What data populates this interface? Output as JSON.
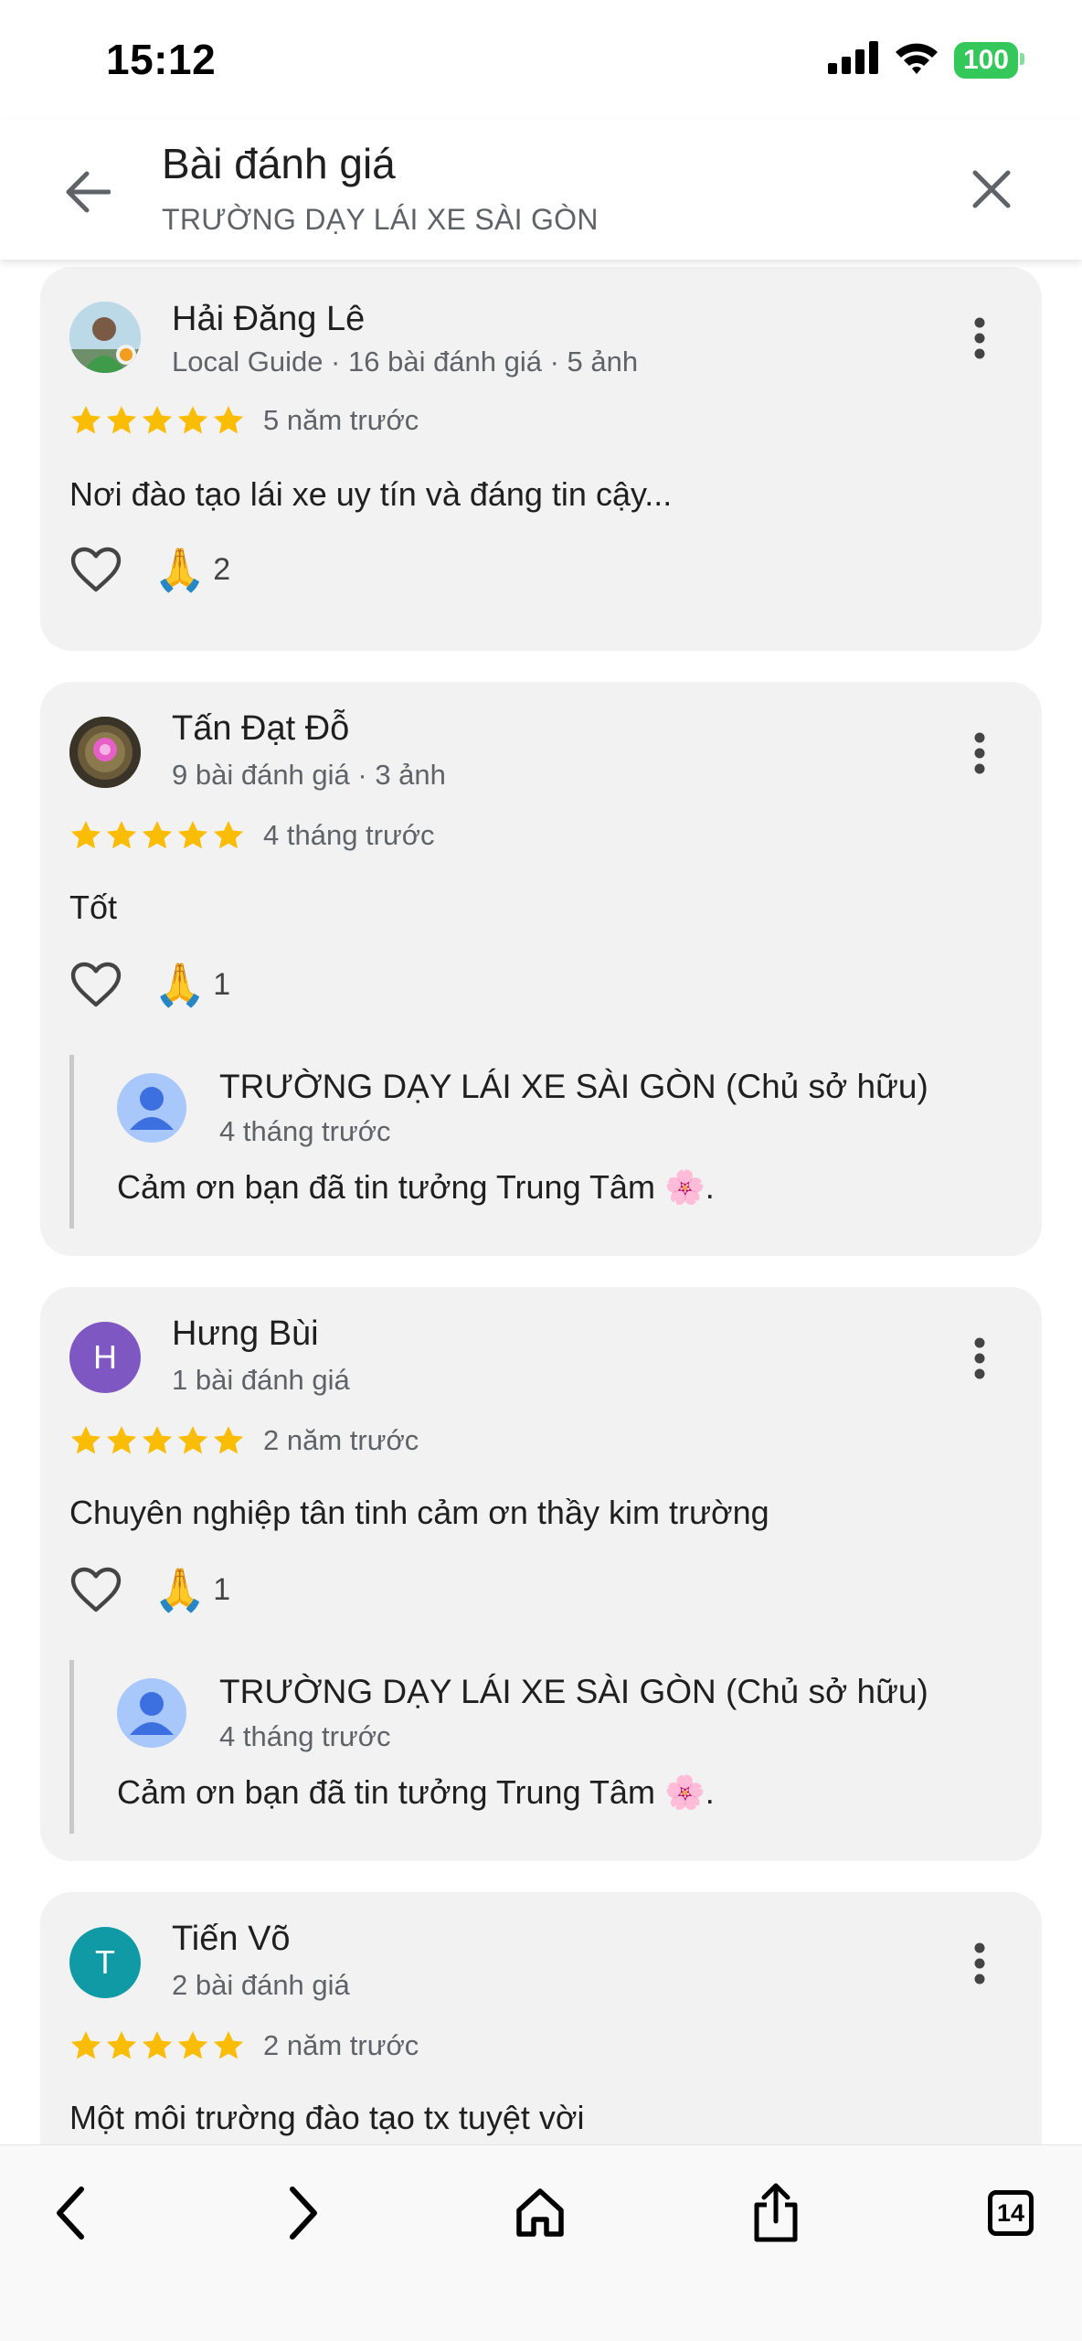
{
  "status_bar": {
    "time": "15:12",
    "battery": "100"
  },
  "header": {
    "title": "Bài đánh giá",
    "subtitle": "TRƯỜNG DẠY LÁI XE SÀI GÒN"
  },
  "reviews": [
    {
      "name": "Hải Đăng Lê",
      "meta": "Local Guide · 16 bài đánh giá · 5 ảnh",
      "rating": 5,
      "time": "5 năm trước",
      "text": "Nơi đào tạo lái xe uy tín và đáng tin cậy...",
      "pray_emoji": "🙏",
      "pray_count": "2"
    },
    {
      "name": "Tấn Đạt Đỗ",
      "meta": "9 bài đánh giá · 3 ảnh",
      "rating": 5,
      "time": "4 tháng trước",
      "text": "Tốt",
      "pray_emoji": "🙏",
      "pray_count": "1",
      "owner_reply": {
        "name": "TRƯỜNG DẠY LÁI XE SÀI GÒN (Chủ sở hữu)",
        "time": "4 tháng trước",
        "text": "Cảm ơn bạn đã tin tưởng Trung Tâm 🌸."
      }
    },
    {
      "name": "Hưng Bùi",
      "initial": "H",
      "avatar_color": "#7e57c2",
      "meta": "1 bài đánh giá",
      "rating": 5,
      "time": "2 năm trước",
      "text": "Chuyên nghiệp tân tinh cảm ơn thầy kim trường",
      "pray_emoji": "🙏",
      "pray_count": "1",
      "owner_reply": {
        "name": "TRƯỜNG DẠY LÁI XE SÀI GÒN (Chủ sở hữu)",
        "time": "4 tháng trước",
        "text": "Cảm ơn bạn đã tin tưởng Trung Tâm 🌸."
      }
    },
    {
      "name": "Tiến Võ",
      "initial": "T",
      "avatar_color": "#0f9aa5",
      "meta": "2 bài đánh giá",
      "rating": 5,
      "time": "2 năm trước",
      "text": "Một môi trường đào tạo tx tuyệt vời"
    }
  ],
  "toolbar": {
    "tabs_count": "14"
  },
  "colors": {
    "star": "#fbbc04",
    "card_bg": "#f2f2f2",
    "battery": "#34c759"
  },
  "icons": [
    "back-arrow-icon",
    "close-icon",
    "more-vert-icon",
    "star-icon",
    "heart-outline-icon",
    "person-icon",
    "chevron-left-icon",
    "chevron-right-icon",
    "home-icon",
    "share-icon",
    "tabs-icon",
    "signal-icon",
    "wifi-icon"
  ]
}
